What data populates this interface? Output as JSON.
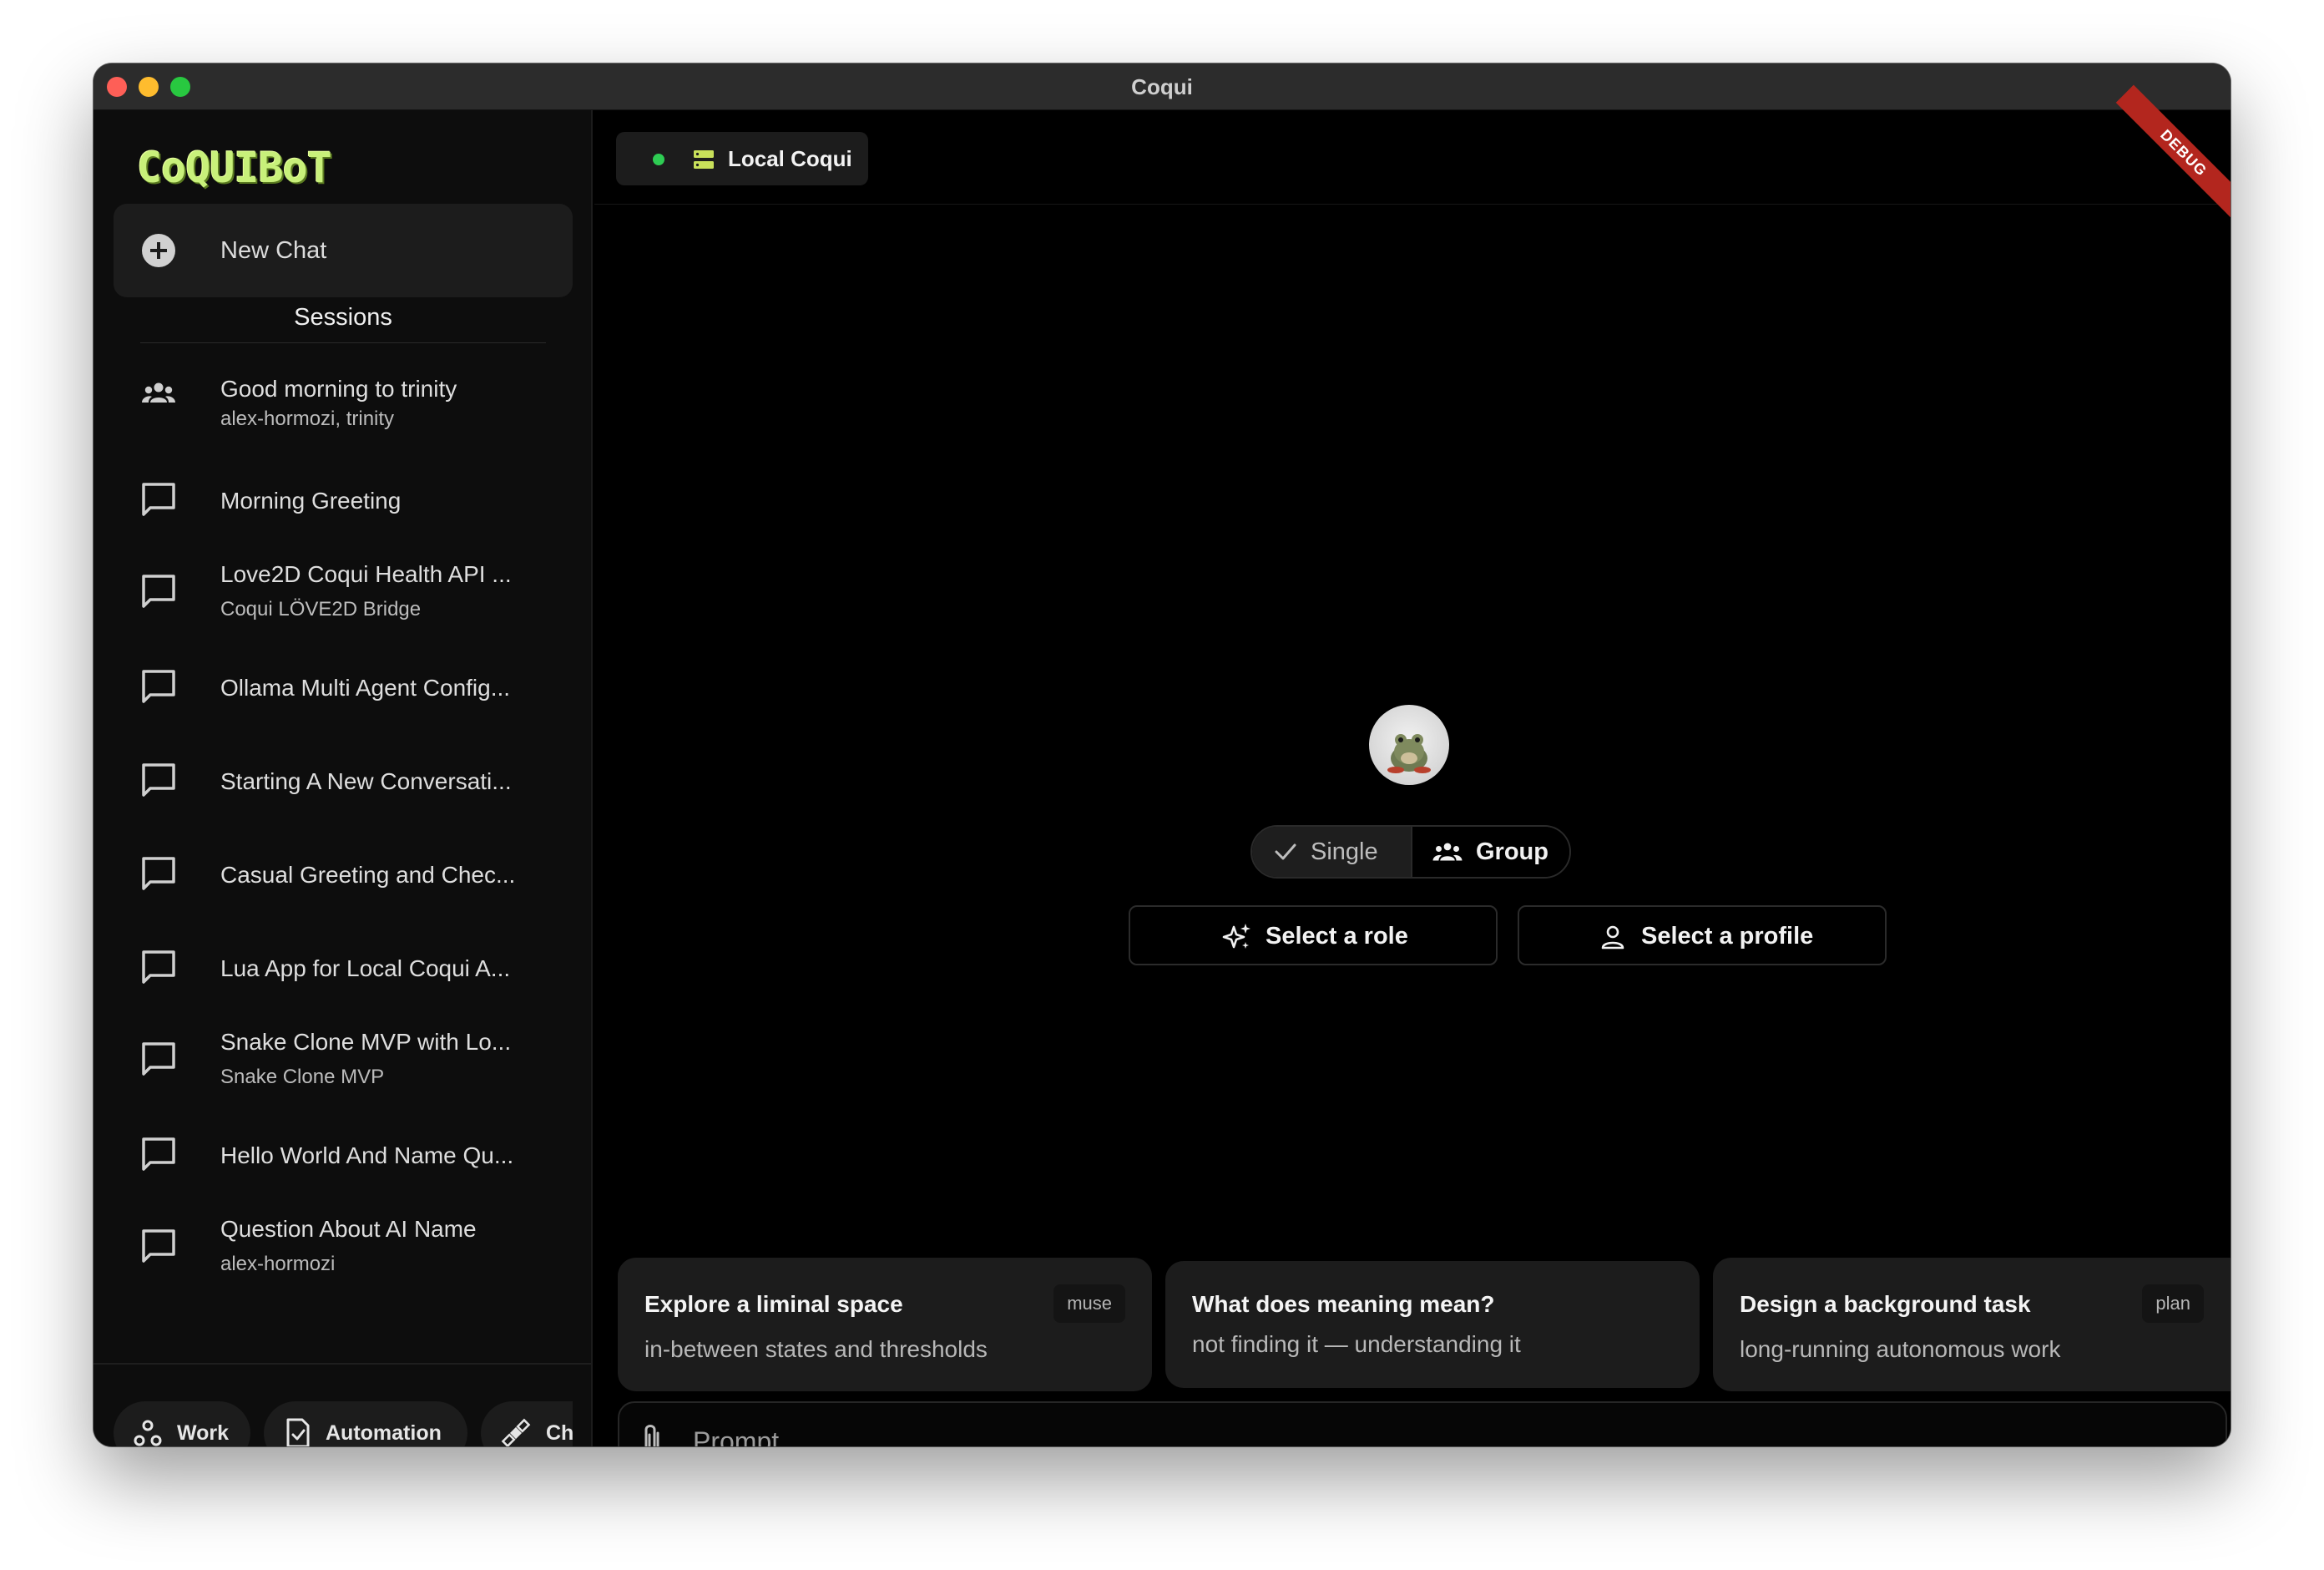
{
  "window": {
    "title": "Coqui"
  },
  "sidebar": {
    "logo_text": "CoQUIBoT",
    "new_chat_label": "New Chat",
    "sessions_heading": "Sessions",
    "sessions": [
      {
        "title": "Good morning to trinity",
        "subtitle": "alex-hormozi, trinity",
        "icon": "group-icon"
      },
      {
        "title": "Morning Greeting",
        "subtitle": "",
        "icon": "chat-bubble-icon"
      },
      {
        "title": "Love2D Coqui Health API ...",
        "subtitle": "Coqui LÖVE2D Bridge",
        "icon": "chat-bubble-icon"
      },
      {
        "title": "Ollama Multi Agent Config...",
        "subtitle": "",
        "icon": "chat-bubble-icon"
      },
      {
        "title": "Starting A New Conversati...",
        "subtitle": "",
        "icon": "chat-bubble-icon"
      },
      {
        "title": "Casual Greeting and Chec...",
        "subtitle": "",
        "icon": "chat-bubble-icon"
      },
      {
        "title": "Lua App for Local Coqui A...",
        "subtitle": "",
        "icon": "chat-bubble-icon"
      },
      {
        "title": "Snake Clone MVP with Lo...",
        "subtitle": "Snake Clone MVP",
        "icon": "chat-bubble-icon"
      },
      {
        "title": "Hello World And Name Qu...",
        "subtitle": "",
        "icon": "chat-bubble-icon"
      },
      {
        "title": "Question About AI Name",
        "subtitle": "alex-hormozi",
        "icon": "chat-bubble-icon"
      }
    ],
    "footer_chips": [
      {
        "label": "Work",
        "icon": "workflow-nodes-icon"
      },
      {
        "label": "Automation",
        "icon": "task-checklist-icon"
      },
      {
        "label": "Ch",
        "icon": "satellite-icon"
      }
    ]
  },
  "header": {
    "server_label": "Local Coqui",
    "server_status": "online",
    "debug_label": "DEBUG"
  },
  "mode_toggle": {
    "options": [
      "Single",
      "Group"
    ],
    "selected": "Single"
  },
  "selectors": {
    "role_label": "Select a role",
    "profile_label": "Select a profile"
  },
  "suggestions": [
    {
      "title": "Explore a liminal space",
      "subtitle": "in-between states and thresholds",
      "tag": "muse"
    },
    {
      "title": "What does meaning mean?",
      "subtitle": "not finding it — understanding it",
      "tag": ""
    },
    {
      "title": "Design a background task",
      "subtitle": "long-running autonomous work",
      "tag": "plan"
    }
  ],
  "prompt": {
    "placeholder": "Prompt",
    "value": ""
  },
  "colors": {
    "accent_logo": "#c8f07a",
    "status_online": "#2ecc53",
    "debug_banner": "#b3261e",
    "surface": "#1c1c1c",
    "background": "#000000"
  }
}
